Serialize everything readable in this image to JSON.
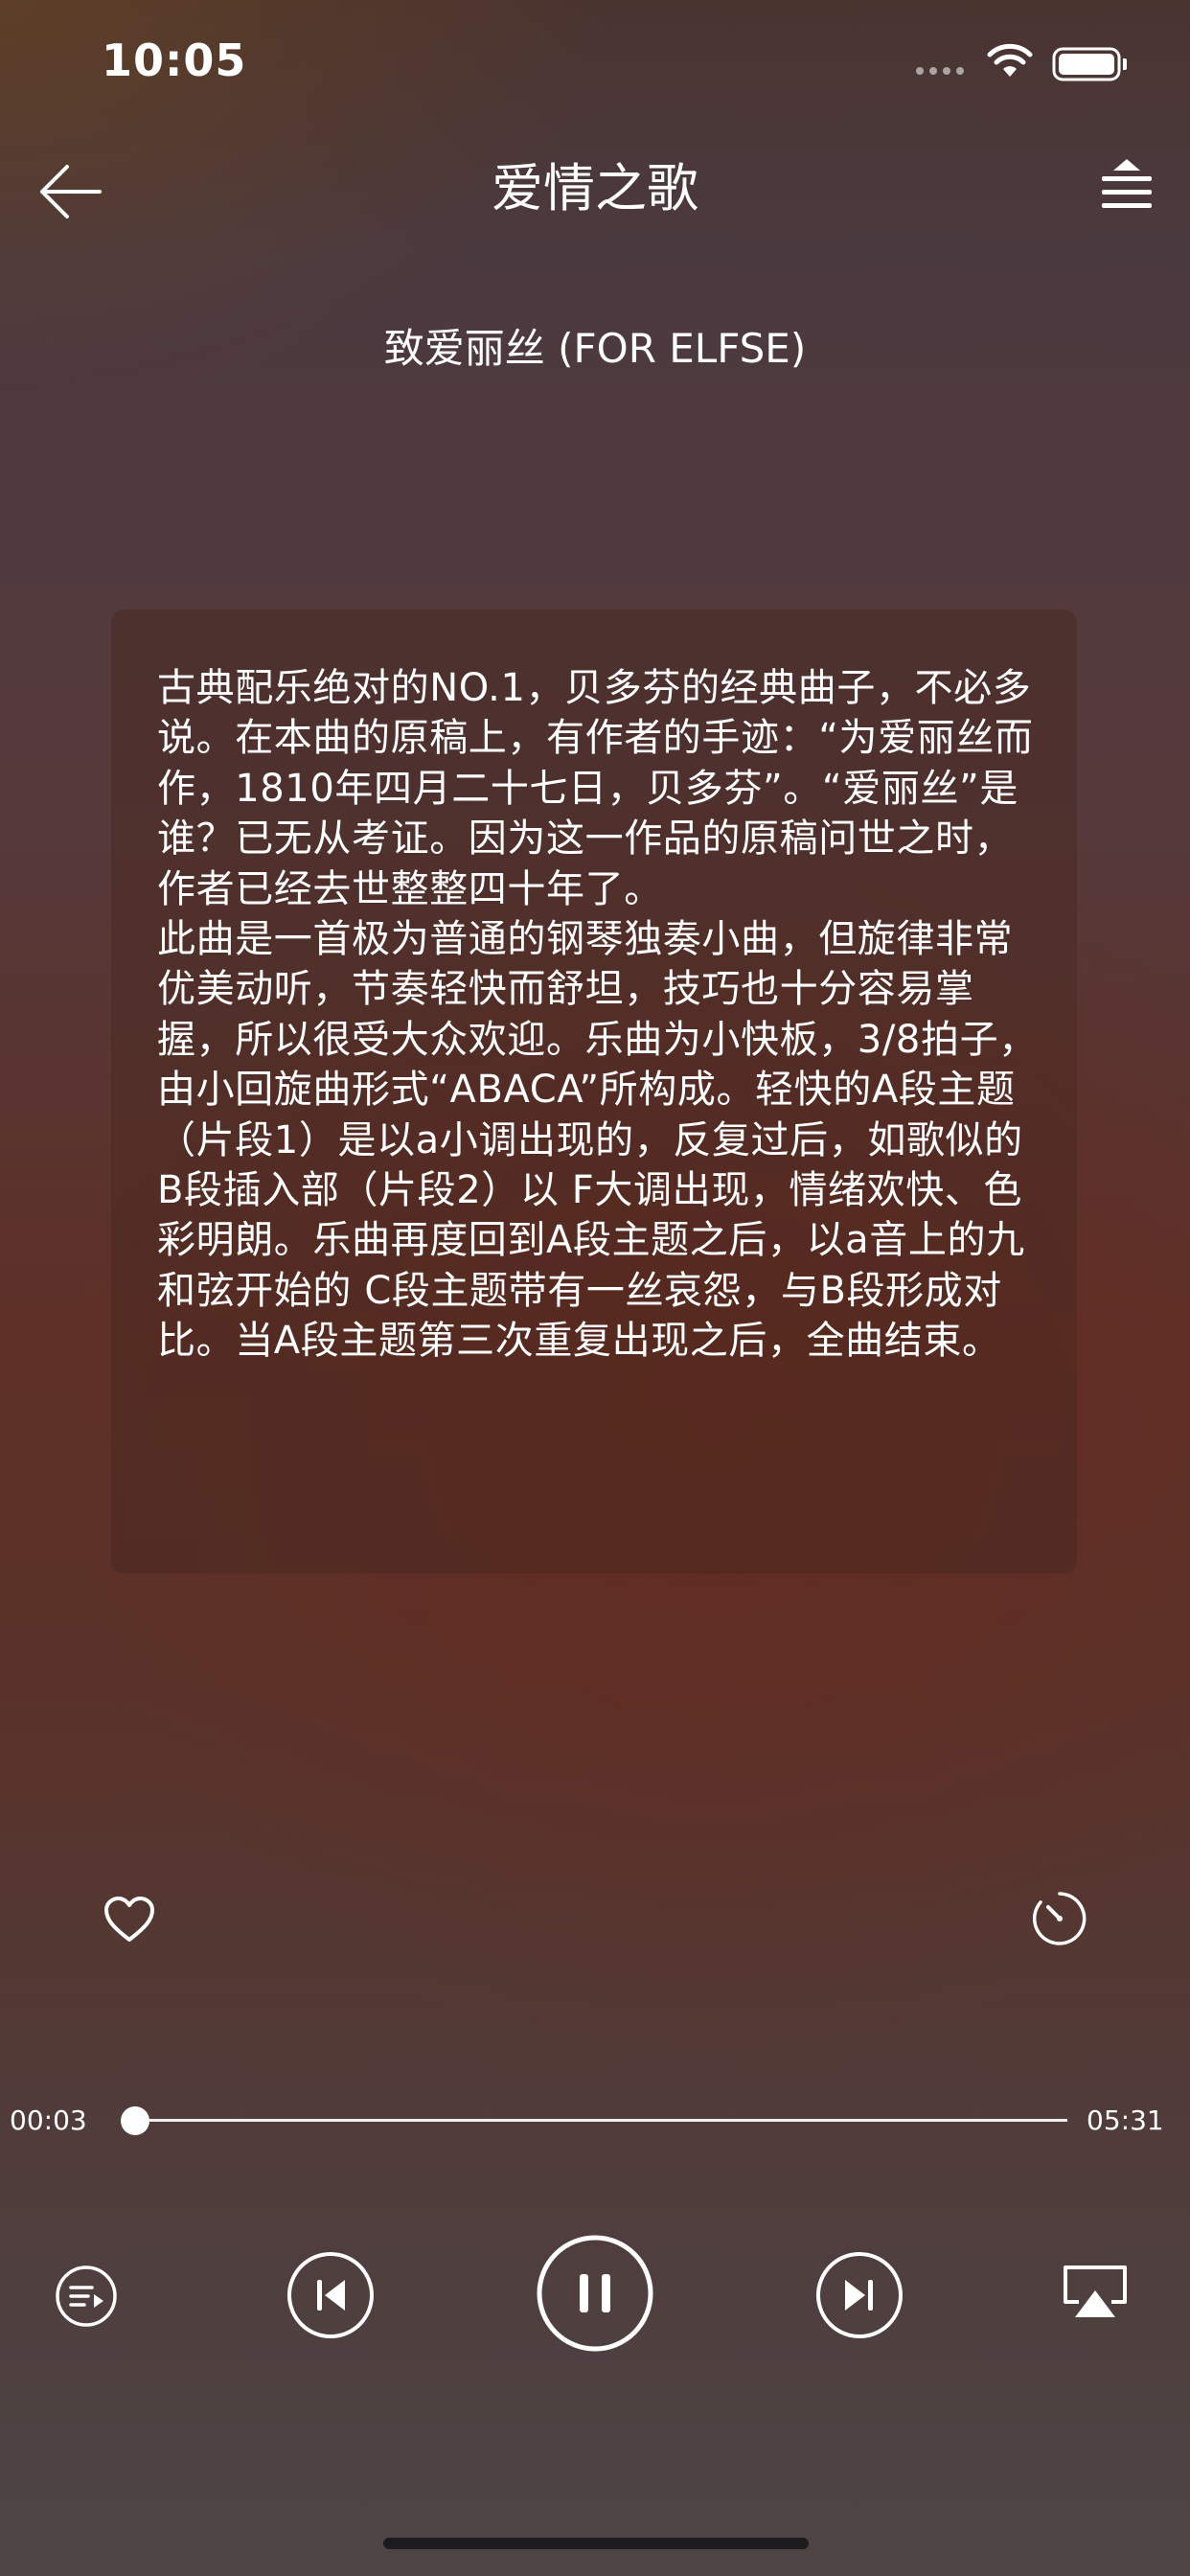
{
  "status_bar": {
    "time": "10:05",
    "icons": [
      "signal-icon",
      "wifi-icon",
      "battery-icon"
    ]
  },
  "nav": {
    "title": "爱情之歌",
    "back_icon": "arrow-left-icon",
    "menu_icon": "playlist-icon"
  },
  "song": {
    "title": "致爱丽丝 (FOR ELFSE)"
  },
  "description": {
    "text": "古典配乐绝对的NO.1，贝多芬的经典曲子，不必多说。在本曲的原稿上，有作者的手迹：“为爱丽丝而作，1810年四月二十七日，贝多芬”。“爱丽丝”是谁？已无从考证。因为这一作品的原稿问世之时，作者已经去世整整四十年了。\n此曲是一首极为普通的钢琴独奏小曲，但旋律非常优美动听，节奏轻快而舒坦，技巧也十分容易掌握，所以很受大众欢迎。乐曲为小快板，3/8拍子，由小回旋曲形式“ABACA”所构成。轻快的A段主题（片段1）是以a小调出现的，反复过后，如歌似的B段插入部（片段2）以 F大调出现，情绪欢快、色彩明朗。乐曲再度回到A段主题之后，以a音上的九和弦开始的 C段主题带有一丝哀怨，与B段形成对比。当A段主题第三次重复出现之后，全曲结束。"
  },
  "actions": {
    "like_icon": "heart-icon",
    "timer_icon": "timer-icon"
  },
  "progress": {
    "current": "00:03",
    "total": "05:31",
    "fraction": 0.009
  },
  "controls": {
    "icons": [
      "playlist-order-icon",
      "previous-icon",
      "pause-icon",
      "next-icon",
      "airplay-icon"
    ]
  },
  "colors": {
    "text": "#ffffff",
    "card": "#48281e",
    "home_indicator": "#1c1c1e"
  }
}
